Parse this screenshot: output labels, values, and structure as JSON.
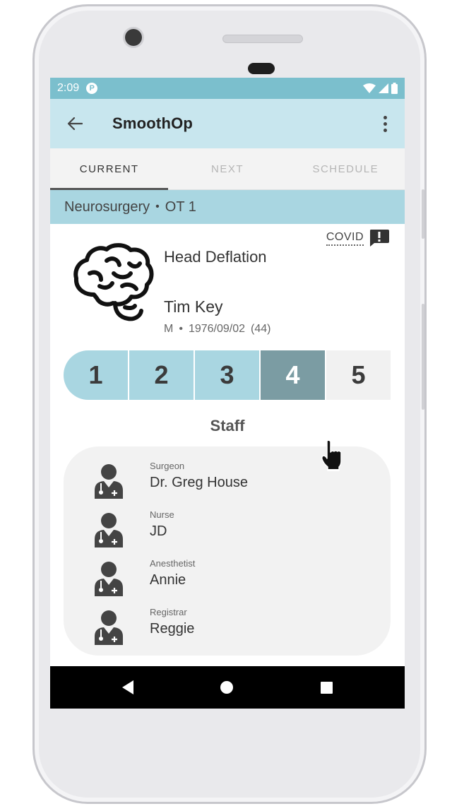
{
  "status_bar": {
    "time": "2:09",
    "app_icon_letter": "P"
  },
  "app_bar": {
    "title": "SmoothOp",
    "back_icon": "arrow-left-icon",
    "menu_icon": "more-vert-icon"
  },
  "tabs": [
    {
      "label": "CURRENT",
      "active": true
    },
    {
      "label": "NEXT",
      "active": false
    },
    {
      "label": "SCHEDULE",
      "active": false
    }
  ],
  "location": {
    "department": "Neurosurgery",
    "separator": "•",
    "theatre": "OT 1"
  },
  "case": {
    "covid_label": "COVID",
    "covid_icon": "alert-message-icon",
    "procedure_icon": "brain-icon",
    "procedure": "Head Deflation",
    "patient_name": "Tim Key",
    "patient_sex": "M",
    "meta_separator": "•",
    "patient_dob": "1976/09/02",
    "patient_age": "(44)"
  },
  "stepper": {
    "steps": [
      "1",
      "2",
      "3",
      "4",
      "5"
    ],
    "current_step": 4
  },
  "staff": {
    "title": "Staff",
    "members": [
      {
        "role": "Surgeon",
        "name": "Dr. Greg House",
        "icon": "doctor-icon"
      },
      {
        "role": "Nurse",
        "name": "JD",
        "icon": "doctor-icon"
      },
      {
        "role": "Anesthetist",
        "name": "Annie",
        "icon": "doctor-icon"
      },
      {
        "role": "Registrar",
        "name": "Reggie",
        "icon": "doctor-icon"
      }
    ]
  },
  "colors": {
    "status_bar": "#7bbfcd",
    "app_bar": "#c8e6ee",
    "department_bar": "#a9d6e1",
    "step_done": "#a9d6e1",
    "step_current": "#7b9ca3",
    "step_future": "#f1f1f1",
    "staff_card": "#f2f2f2"
  }
}
